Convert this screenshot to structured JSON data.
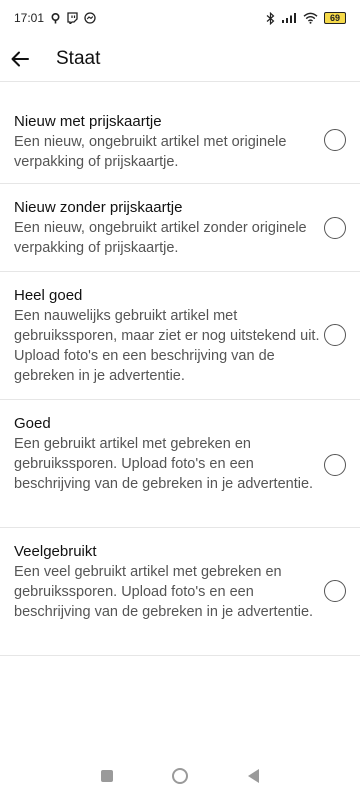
{
  "status_bar": {
    "time": "17:01",
    "battery": "69"
  },
  "header": {
    "title": "Staat"
  },
  "options": [
    {
      "title": "Nieuw met prijskaartje",
      "description": "Een nieuw, ongebruikt artikel met originele verpakking of prijskaartje.",
      "selected": false
    },
    {
      "title": "Nieuw zonder prijskaartje",
      "description": "Een nieuw, ongebruikt artikel zonder originele verpakking of prijskaartje.",
      "selected": false
    },
    {
      "title": "Heel goed",
      "description": "Een nauwelijks gebruikt artikel met gebruikssporen, maar ziet er nog uitstekend uit. Upload foto's en een beschrijving van de gebreken in je advertentie.",
      "selected": false
    },
    {
      "title": "Goed",
      "description": "Een gebruikt artikel met gebreken en gebruikssporen. Upload foto's en een beschrijving van de gebreken in je advertentie.",
      "selected": false
    },
    {
      "title": "Veelgebruikt",
      "description": "Een veel gebruikt artikel met gebreken en gebruikssporen. Upload foto's en een beschrijving van de gebreken in je advertentie.",
      "selected": false
    }
  ],
  "icons": {
    "status_left": [
      "notification-a-icon",
      "twitch-icon",
      "messenger-icon"
    ],
    "status_right": [
      "bluetooth-icon",
      "signal-icon",
      "wifi-icon",
      "battery-icon"
    ],
    "back": "arrow-left-icon",
    "nav": [
      "recents-icon",
      "home-icon",
      "back-triangle-icon"
    ]
  }
}
